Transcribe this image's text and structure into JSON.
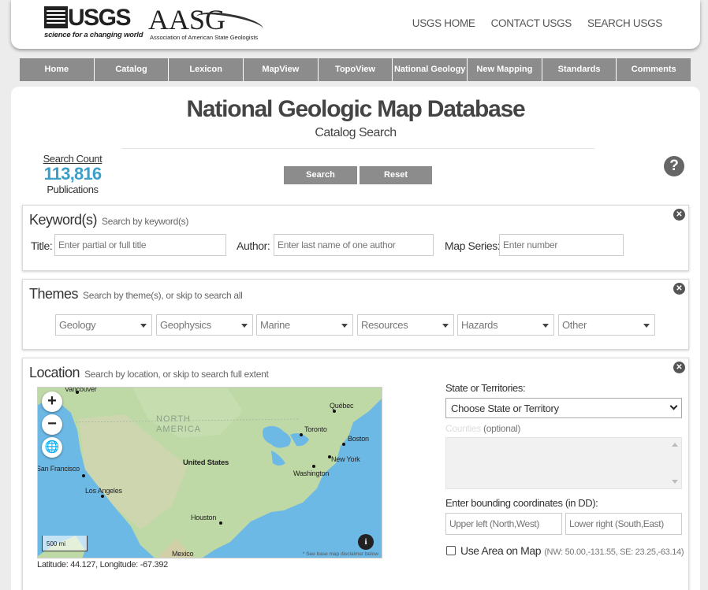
{
  "header": {
    "usgs_logo_text": "USGS",
    "usgs_tagline": "science for a changing world",
    "aasg_logo_text": "AASG",
    "aasg_tagline": "Association of American State Geologists",
    "links": [
      "USGS HOME",
      "CONTACT USGS",
      "SEARCH USGS"
    ]
  },
  "nav": {
    "items": [
      "Home",
      "Catalog",
      "Lexicon",
      "MapView",
      "TopoView",
      "National Geology",
      "New Mapping",
      "Standards",
      "Comments"
    ],
    "bg_color": "#8c8c8c"
  },
  "page": {
    "title": "National Geologic Map Database",
    "subtitle": "Catalog Search"
  },
  "search_count": {
    "label": "Search Count",
    "value": "113,816",
    "unit": "Publications",
    "value_color": "#3a9fc9"
  },
  "actions": {
    "search_label": "Search",
    "reset_label": "Reset",
    "help_glyph": "?"
  },
  "keywords": {
    "title": "Keyword(s)",
    "hint": "Search by keyword(s)",
    "title_label": "Title:",
    "title_placeholder": "Enter partial or full title",
    "author_label": "Author:",
    "author_placeholder": "Enter last name of one author",
    "series_label": "Map Series:",
    "series_placeholder": "Enter number"
  },
  "themes": {
    "title": "Themes",
    "hint": "Search by theme(s), or skip to search all",
    "options": [
      "Geology",
      "Geophysics",
      "Marine",
      "Resources",
      "Hazards",
      "Other"
    ]
  },
  "location": {
    "title": "Location",
    "hint": "Search by location, or skip to search full extent",
    "map": {
      "labels": {
        "vancouver": "Vancouver",
        "quebec": "Québec",
        "north_america": "NORTH AMERICA",
        "toronto": "Toronto",
        "boston": "Boston",
        "united_states": "United States",
        "new_york": "New York",
        "washington": "Washington",
        "san_francisco": "San Francisco",
        "los_angeles": "Los Angeles",
        "houston": "Houston",
        "mexico": "Mexico"
      },
      "scale": "500 mi",
      "disclaimer": "* See base map disclaimer below",
      "zoom_in": "+",
      "zoom_out": "−",
      "info_glyph": "i"
    },
    "coords_readout": "Latitude: 44.127, Longitude: -67.392",
    "state_label": "State or Territories:",
    "state_selected": "Choose State or Territory",
    "counties_label": "Counties",
    "counties_optional": "(optional)",
    "bbox_label": "Enter bounding coordinates (in DD):",
    "upper_left_placeholder": "Upper left (North,West)",
    "lower_right_placeholder": "Lower right (South,East)",
    "use_area_label": "Use Area on Map",
    "use_area_note": "(NW: 50.00,-131.55, SE: 23.25,-63.14)"
  }
}
